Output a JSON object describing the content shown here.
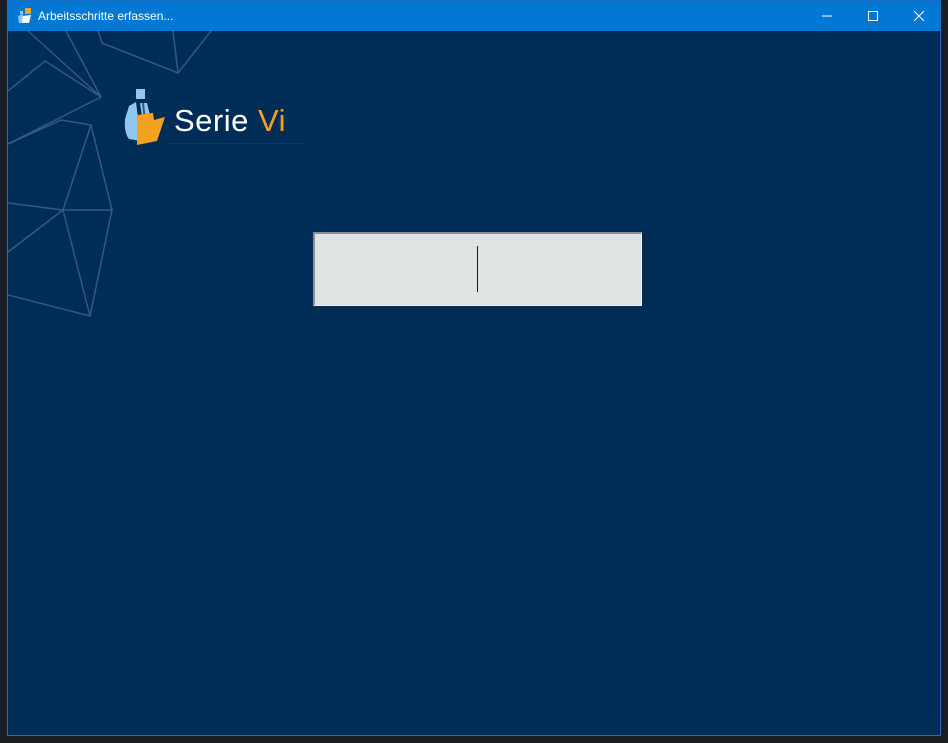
{
  "window": {
    "title": "Arbeitsschritte erfassen...",
    "app_icon": "serie-vi-app-icon",
    "controls": {
      "minimize_icon": "minimize-icon",
      "maximize_icon": "maximize-icon",
      "close_icon": "close-icon"
    }
  },
  "logo": {
    "name_part1": "Serie",
    "name_part2": "Vi",
    "mark_icon": "person-folder-icon"
  },
  "input": {
    "value": "",
    "placeholder": ""
  },
  "colors": {
    "titlebar": "#0078d4",
    "background": "#002d57",
    "accent": "#f5a01e",
    "input_background": "#dfe3e3"
  }
}
